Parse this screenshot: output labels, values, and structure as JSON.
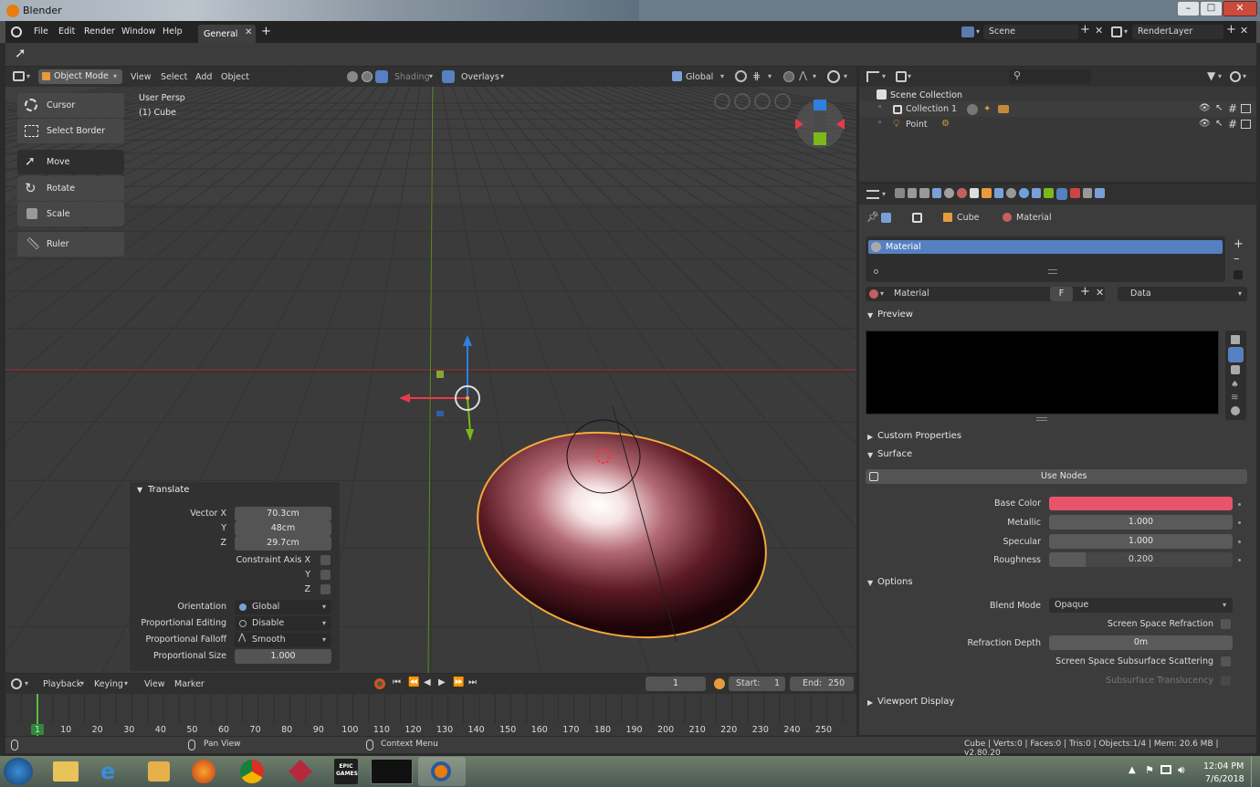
{
  "window": {
    "title": "Blender",
    "controls": [
      "–",
      "□",
      "✕"
    ]
  },
  "menubar": {
    "items": [
      "File",
      "Edit",
      "Render",
      "Window",
      "Help"
    ],
    "workspace_tab": "General",
    "add_tab": "+",
    "scene": "Scene",
    "render_layer": "RenderLayer"
  },
  "viewport_header": {
    "mode": "Object Mode",
    "menus": [
      "View",
      "Select",
      "Add",
      "Object"
    ],
    "shading": "Shading",
    "overlays": "Overlays",
    "orientation": "Global"
  },
  "viewport": {
    "persp_label": "User Persp",
    "object_label": "(1) Cube"
  },
  "tools": [
    "Cursor",
    "Select Border",
    "Move",
    "Rotate",
    "Scale",
    "Ruler"
  ],
  "translate_panel": {
    "title": "Translate",
    "vector_label": "Vector X",
    "y_label": "Y",
    "z_label": "Z",
    "vx": "70.3cm",
    "vy": "48cm",
    "vz": "29.7cm",
    "constraint_label": "Constraint Axis X",
    "cy": "Y",
    "cz": "Z",
    "orientation_label": "Orientation",
    "orientation_value": "Global",
    "prop_edit_label": "Proportional Editing",
    "prop_edit_value": "Disable",
    "prop_falloff_label": "Proportional Falloff",
    "prop_falloff_value": "Smooth",
    "prop_size_label": "Proportional Size",
    "prop_size_value": "1.000"
  },
  "timeline": {
    "menus": [
      "Playback",
      "Keying",
      "View",
      "Marker"
    ],
    "current_frame": "1",
    "start_label": "Start:",
    "start": "1",
    "end_label": "End:",
    "end": "250",
    "ticks": [
      "1",
      "10",
      "20",
      "30",
      "40",
      "50",
      "60",
      "70",
      "80",
      "90",
      "100",
      "110",
      "120",
      "130",
      "140",
      "150",
      "160",
      "170",
      "180",
      "190",
      "200",
      "210",
      "220",
      "230",
      "240",
      "250"
    ]
  },
  "statusbar": {
    "pan": "Pan View",
    "context": "Context Menu",
    "stats": "Cube | Verts:0 | Faces:0 | Tris:0 | Objects:1/4 | Mem: 20.6 MB | v2.80.20"
  },
  "outliner": {
    "root": "Scene Collection",
    "collection": "Collection 1",
    "point": "Point"
  },
  "properties": {
    "cube": "Cube",
    "material": "Material",
    "slot": "Material",
    "datablock": "Material",
    "fake_user": "F",
    "link": "Data",
    "preview": "Preview",
    "custom_props": "Custom Properties",
    "surface": "Surface",
    "use_nodes": "Use Nodes",
    "base_color_label": "Base Color",
    "base_color": "#e8546a",
    "metallic_label": "Metallic",
    "metallic": "1.000",
    "specular_label": "Specular",
    "specular": "1.000",
    "roughness_label": "Roughness",
    "roughness": "0.200",
    "options": "Options",
    "blend_label": "Blend Mode",
    "blend": "Opaque",
    "ssr": "Screen Space Refraction",
    "refr_depth_label": "Refraction Depth",
    "refr_depth": "0m",
    "sss": "Screen Space Subsurface Scattering",
    "sub_trans": "Subsurface Translucency",
    "viewport_display": "Viewport Display"
  },
  "taskbar": {
    "time": "12:04 PM",
    "date": "7/6/2018",
    "epic": "EPIC GAMES"
  },
  "colors": {
    "accent": "#5680c2",
    "selected_outline": "#f4a93b",
    "axis_x": "#c1323d",
    "axis_y": "#7bb81a",
    "axis_z": "#2f7fe0"
  }
}
